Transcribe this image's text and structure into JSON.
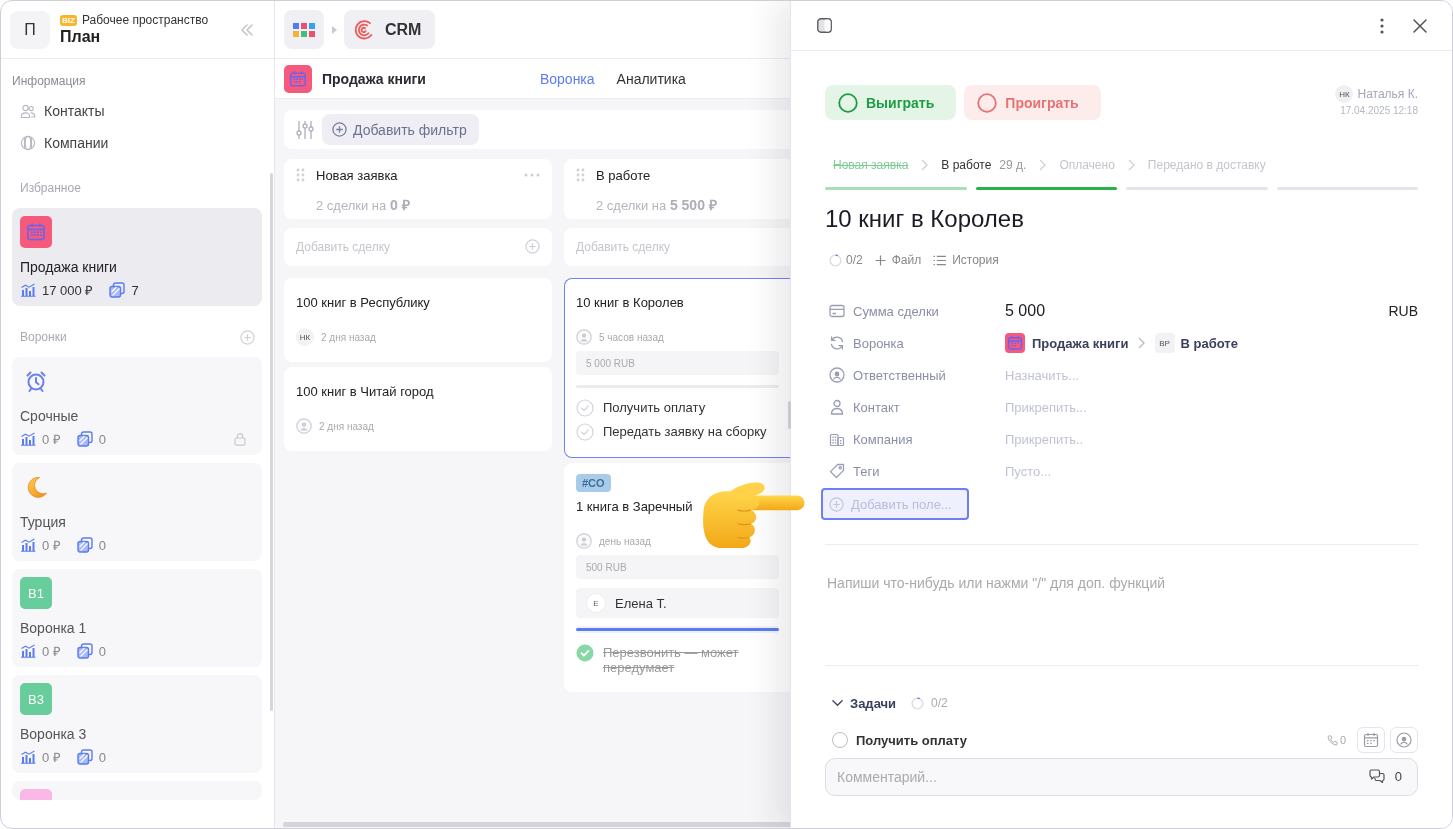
{
  "sidebar": {
    "workspace": {
      "avatar": "П",
      "badge": "BIZ",
      "label": "Рабочее пространство",
      "name": "План"
    },
    "info": {
      "title": "Информация",
      "items": [
        "Контакты",
        "Компании"
      ]
    },
    "favorites": {
      "title": "Избранное",
      "items": [
        {
          "name": "Продажа книги",
          "amount": "17 000 ₽",
          "count": "7",
          "selected": true
        }
      ]
    },
    "funnels": {
      "title": "Воронки",
      "items": [
        {
          "icon": {
            "kind": "symbol"
          },
          "name": "Срочные",
          "amount": "0 ₽",
          "count": "0",
          "locked": true,
          "selected": false
        },
        {
          "icon": {
            "kind": "symbol"
          },
          "name": "Турция",
          "amount": "0 ₽",
          "count": "0",
          "locked": false,
          "selected": false
        },
        {
          "icon": {
            "kind": "letters",
            "text": "В1",
            "color": "#66cd9b"
          },
          "name": "Воронка 1",
          "amount": "0 ₽",
          "count": "0",
          "locked": false,
          "selected": false
        },
        {
          "icon": {
            "kind": "letters",
            "text": "В3",
            "color": "#66cd9b"
          },
          "name": "Воронка 3",
          "amount": "0 ₽",
          "count": "0",
          "locked": false,
          "selected": false
        },
        {
          "icon": {
            "kind": "letters",
            "color": "#f9b8e6"
          }
        }
      ]
    }
  },
  "topbar": {
    "app": "CRM"
  },
  "board": {
    "title": "Продажа книги",
    "tabs": [
      {
        "label": "Воронка",
        "selected": true
      },
      {
        "label": "Аналитика",
        "selected": false
      }
    ],
    "add_filter": "Добавить фильтр",
    "columns": [
      {
        "title": "Новая заявка",
        "summary": "2 сделки на **0 ₽**",
        "add_placeholder": "Добавить сделку",
        "cards": [
          {
            "title": "100 книг в Республику",
            "selected": false,
            "author": "НК",
            "time": "2 дня назад"
          },
          {
            "title": "100 книг в Читай город",
            "selected": false,
            "time": "2 дня назад"
          }
        ]
      },
      {
        "title": "В работе",
        "summary": "2 сделки на **5 500 ₽**",
        "add_placeholder": "Добавить сделку",
        "cards": [
          {
            "title": "10 книг в Королев",
            "selected": true,
            "time": "5 часов назад",
            "amount": "5 000 RUB",
            "tasks": [
              {
                "label": "Получить оплату",
                "done": false
              },
              {
                "label": "Передать заявку на сборку",
                "done": false
              }
            ]
          },
          {
            "tag": "#CO",
            "title": "1 книга в Заречный",
            "selected": false,
            "time": "день назад",
            "amount": "500 RUB",
            "contact": {
              "initials": "Е",
              "name": "Елена Т."
            },
            "progress": {
              "level": 1
            },
            "tasks": [
              {
                "label": "Перезвонить — может передумает",
                "done": true
              }
            ]
          }
        ]
      }
    ]
  },
  "deal": {
    "outcomes": [
      {
        "label": "Выиграть",
        "kind": "win"
      },
      {
        "label": "Проиграть",
        "kind": "lose"
      }
    ],
    "author": {
      "initials": "НК",
      "name": "Наталья К.",
      "date": "17.04.2025 12:18"
    },
    "stages": [
      {
        "label": "Новая заявка",
        "done": true,
        "selected": false
      },
      {
        "label": "В работе",
        "duration": "29 д.",
        "done": false,
        "selected": true
      },
      {
        "label": "Оплачено",
        "done": false,
        "selected": false
      },
      {
        "label": "Передано в доставку",
        "done": false,
        "selected": false
      }
    ],
    "title": "10 книг в Королев",
    "meta": {
      "tasks": "0/2",
      "file": "Файл",
      "history": "История"
    },
    "fields": [
      {
        "label": "Сумма сделки",
        "kind": "amount",
        "value": "5 000",
        "currency": "RUB"
      },
      {
        "label": "Воронка",
        "kind": "pipeline",
        "funnel": "Продажа книги",
        "stage_initials": "ВР",
        "stage": "В работе"
      },
      {
        "label": "Ответственный",
        "kind": "empty",
        "placeholder": "Назначить..."
      },
      {
        "label": "Контакт",
        "kind": "empty",
        "placeholder": "Прикрепить..."
      },
      {
        "label": "Компания",
        "kind": "empty",
        "placeholder": "Прикрепить.."
      },
      {
        "label": "Теги",
        "kind": "empty",
        "placeholder": "Пусто..."
      }
    ],
    "add_field": {
      "label": "Добавить поле...",
      "focused": true
    },
    "editor": {
      "placeholder": "Напиши что-нибудь или нажми \"/\" для доп. функций"
    },
    "tasks": {
      "title": "Задачи",
      "expanded": true,
      "progress": "0/2",
      "items": [
        {
          "label": "Получить оплату",
          "done": false,
          "calls": "0"
        }
      ]
    },
    "comment": {
      "placeholder": "Комментарий...",
      "count": "0"
    }
  }
}
